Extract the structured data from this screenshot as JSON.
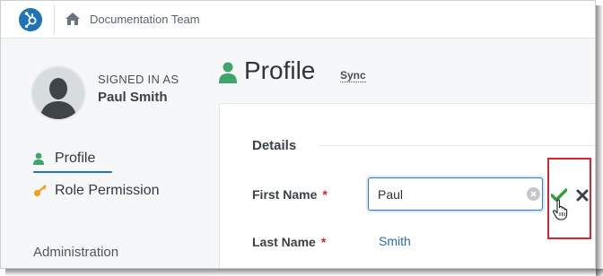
{
  "topbar": {
    "team_name": "Documentation Team",
    "logo_icon": "hub-logo-icon",
    "home_icon": "home-icon"
  },
  "user": {
    "signed_in_label": "SIGNED IN AS",
    "name": "Paul Smith"
  },
  "sidebar": {
    "items": [
      {
        "label": "Profile",
        "icon": "user-icon",
        "active": true
      },
      {
        "label": "Role Permission",
        "icon": "key-icon",
        "active": false
      }
    ],
    "admin_heading": "Administration"
  },
  "page": {
    "title": "Profile",
    "sync_label": "Sync"
  },
  "details": {
    "section_title": "Details",
    "first_name_label": "First Name",
    "first_name_value": "Paul",
    "last_name_label": "Last Name",
    "last_name_value": "Smith",
    "required_mark": "*"
  },
  "colors": {
    "brand": "#1f73b7",
    "accent_green": "#2e9e3a",
    "required_red": "#d0242e",
    "highlight_red": "#e0242e"
  }
}
